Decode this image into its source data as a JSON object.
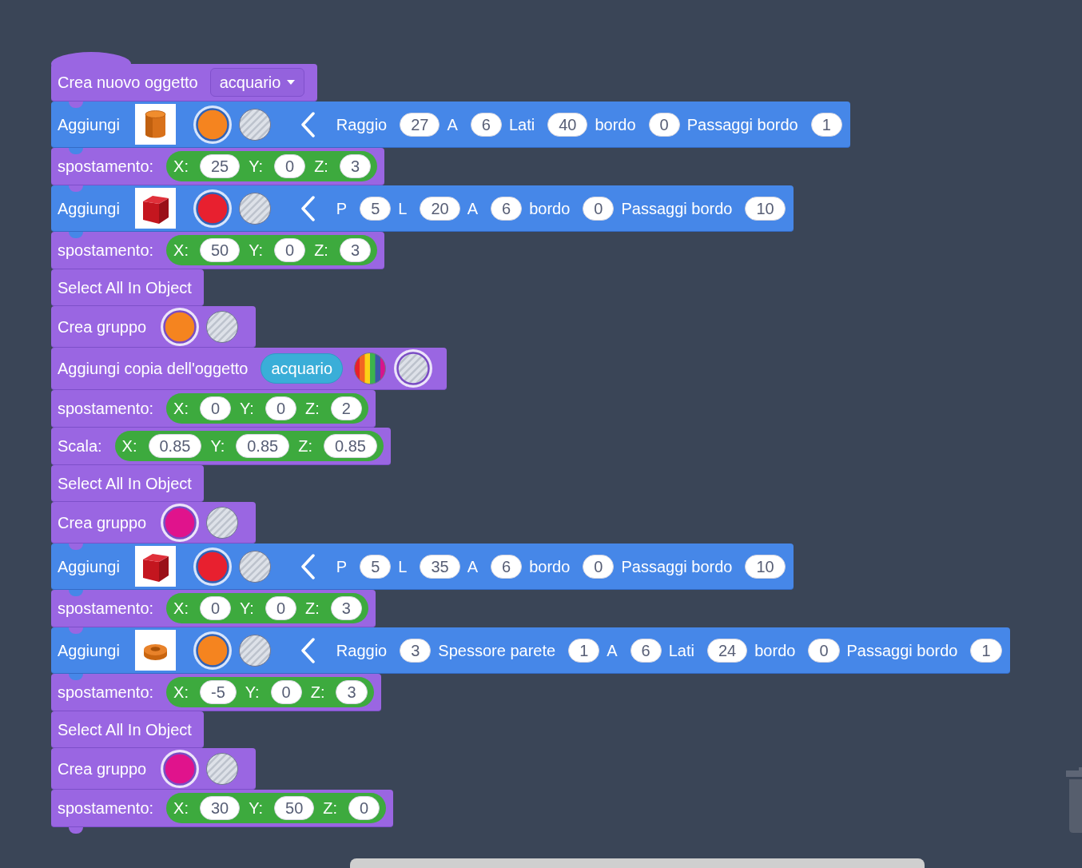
{
  "workspace": {
    "blocks": [
      {
        "kind": "create_object",
        "label": "Crea nuovo oggetto",
        "dropdown": "acquario"
      },
      {
        "kind": "add_shape",
        "label": "Aggiungi",
        "thumbnail": {
          "kind": "cylinder"
        },
        "swatches": [
          {
            "kind": "solid",
            "color": "#f5841f",
            "selected": true
          },
          {
            "kind": "transparent",
            "selected": false
          }
        ],
        "params": [
          {
            "label": "Raggio",
            "value": "27"
          },
          {
            "label": "A",
            "value": "6"
          },
          {
            "label": "Lati",
            "value": "40"
          },
          {
            "label": "bordo",
            "value": "0"
          },
          {
            "label": "Passaggi bordo",
            "value": "1"
          }
        ]
      },
      {
        "kind": "move",
        "label": "spostamento:",
        "vector": [
          {
            "axis": "X:",
            "value": "25"
          },
          {
            "axis": "Y:",
            "value": "0"
          },
          {
            "axis": "Z:",
            "value": "3"
          }
        ]
      },
      {
        "kind": "add_shape",
        "label": "Aggiungi",
        "thumbnail": {
          "kind": "cube"
        },
        "swatches": [
          {
            "kind": "solid",
            "color": "#e8202f",
            "selected": true
          },
          {
            "kind": "transparent",
            "selected": false
          }
        ],
        "params": [
          {
            "label": "P",
            "value": "5"
          },
          {
            "label": "L",
            "value": "20"
          },
          {
            "label": "A",
            "value": "6"
          },
          {
            "label": "bordo",
            "value": "0"
          },
          {
            "label": "Passaggi bordo",
            "value": "10"
          }
        ]
      },
      {
        "kind": "move",
        "label": "spostamento:",
        "vector": [
          {
            "axis": "X:",
            "value": "50"
          },
          {
            "axis": "Y:",
            "value": "0"
          },
          {
            "axis": "Z:",
            "value": "3"
          }
        ]
      },
      {
        "kind": "select_all",
        "label": "Select All In Object"
      },
      {
        "kind": "group",
        "label": "Crea gruppo",
        "swatches": [
          {
            "kind": "solid",
            "color": "#f5841f",
            "selected": true
          },
          {
            "kind": "transparent",
            "selected": false
          }
        ]
      },
      {
        "kind": "add_copy",
        "label": "Aggiungi copia dell'oggetto",
        "object": "acquario",
        "swatches": [
          {
            "kind": "rainbow",
            "selected": false
          },
          {
            "kind": "transparent",
            "selected": true
          }
        ]
      },
      {
        "kind": "move",
        "label": "spostamento:",
        "vector": [
          {
            "axis": "X:",
            "value": "0"
          },
          {
            "axis": "Y:",
            "value": "0"
          },
          {
            "axis": "Z:",
            "value": "2"
          }
        ]
      },
      {
        "kind": "scale",
        "label": "Scala:",
        "vector": [
          {
            "axis": "X:",
            "value": "0.85"
          },
          {
            "axis": "Y:",
            "value": "0.85"
          },
          {
            "axis": "Z:",
            "value": "0.85"
          }
        ]
      },
      {
        "kind": "select_all",
        "label": "Select All In Object"
      },
      {
        "kind": "group",
        "label": "Crea gruppo",
        "swatches": [
          {
            "kind": "solid",
            "color": "#e0138c",
            "selected": true
          },
          {
            "kind": "transparent",
            "selected": false
          }
        ]
      },
      {
        "kind": "add_shape",
        "label": "Aggiungi",
        "thumbnail": {
          "kind": "cube"
        },
        "swatches": [
          {
            "kind": "solid",
            "color": "#e8202f",
            "selected": true
          },
          {
            "kind": "transparent",
            "selected": false
          }
        ],
        "params": [
          {
            "label": "P",
            "value": "5"
          },
          {
            "label": "L",
            "value": "35"
          },
          {
            "label": "A",
            "value": "6"
          },
          {
            "label": "bordo",
            "value": "0"
          },
          {
            "label": "Passaggi bordo",
            "value": "10"
          }
        ]
      },
      {
        "kind": "move",
        "label": "spostamento:",
        "vector": [
          {
            "axis": "X:",
            "value": "0"
          },
          {
            "axis": "Y:",
            "value": "0"
          },
          {
            "axis": "Z:",
            "value": "3"
          }
        ]
      },
      {
        "kind": "add_shape",
        "label": "Aggiungi",
        "thumbnail": {
          "kind": "torus"
        },
        "swatches": [
          {
            "kind": "solid",
            "color": "#f5841f",
            "selected": true
          },
          {
            "kind": "transparent",
            "selected": false
          }
        ],
        "params": [
          {
            "label": "Raggio",
            "value": "3"
          },
          {
            "label": "Spessore parete",
            "value": "1"
          },
          {
            "label": "A",
            "value": "6"
          },
          {
            "label": "Lati",
            "value": "24"
          },
          {
            "label": "bordo",
            "value": "0"
          },
          {
            "label": "Passaggi bordo",
            "value": "1"
          }
        ]
      },
      {
        "kind": "move",
        "label": "spostamento:",
        "vector": [
          {
            "axis": "X:",
            "value": "-5"
          },
          {
            "axis": "Y:",
            "value": "0"
          },
          {
            "axis": "Z:",
            "value": "3"
          }
        ]
      },
      {
        "kind": "select_all",
        "label": "Select All In Object"
      },
      {
        "kind": "group",
        "label": "Crea gruppo",
        "swatches": [
          {
            "kind": "solid",
            "color": "#e0138c",
            "selected": true
          },
          {
            "kind": "transparent",
            "selected": false
          }
        ]
      },
      {
        "kind": "move",
        "label": "spostamento:",
        "vector": [
          {
            "axis": "X:",
            "value": "30"
          },
          {
            "axis": "Y:",
            "value": "50"
          },
          {
            "axis": "Z:",
            "value": "0"
          }
        ]
      }
    ]
  }
}
